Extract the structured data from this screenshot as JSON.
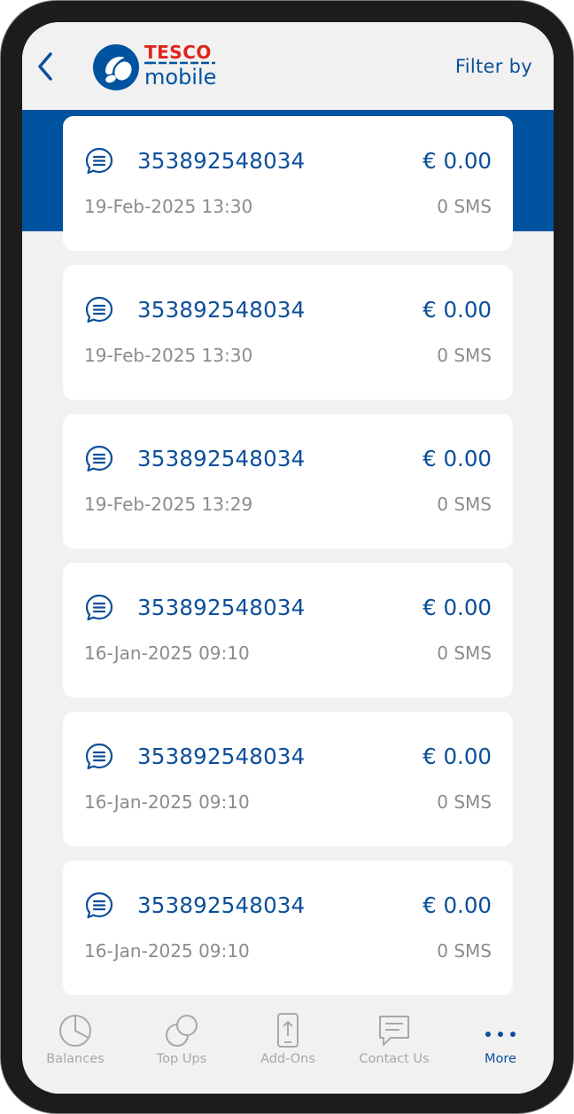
{
  "header": {
    "logo_top": "TESCO",
    "logo_bottom": "mobile",
    "filter_label": "Filter by",
    "back_icon": "chevron-left-icon"
  },
  "colors": {
    "brand_blue": "#00539f",
    "text_blue": "#0b4f9a",
    "tesco_red": "#e2231a",
    "muted": "#8c8c8c"
  },
  "records": [
    {
      "number": "353892548034",
      "amount": "€ 0.00",
      "datetime": "19-Feb-2025 13:30",
      "usage": "0 SMS"
    },
    {
      "number": "353892548034",
      "amount": "€ 0.00",
      "datetime": "19-Feb-2025 13:30",
      "usage": "0 SMS"
    },
    {
      "number": "353892548034",
      "amount": "€ 0.00",
      "datetime": "19-Feb-2025 13:29",
      "usage": "0 SMS"
    },
    {
      "number": "353892548034",
      "amount": "€ 0.00",
      "datetime": "16-Jan-2025 09:10",
      "usage": "0 SMS"
    },
    {
      "number": "353892548034",
      "amount": "€ 0.00",
      "datetime": "16-Jan-2025 09:10",
      "usage": "0 SMS"
    },
    {
      "number": "353892548034",
      "amount": "€ 0.00",
      "datetime": "16-Jan-2025 09:10",
      "usage": "0 SMS"
    }
  ],
  "tabs": [
    {
      "label": "Balances",
      "icon": "pie-chart-icon",
      "active": false
    },
    {
      "label": "Top Ups",
      "icon": "coins-icon",
      "active": false
    },
    {
      "label": "Add-Ons",
      "icon": "phone-upload-icon",
      "active": false
    },
    {
      "label": "Contact Us",
      "icon": "chat-icon",
      "active": false
    },
    {
      "label": "More",
      "icon": "more-dots-icon",
      "active": true
    }
  ]
}
